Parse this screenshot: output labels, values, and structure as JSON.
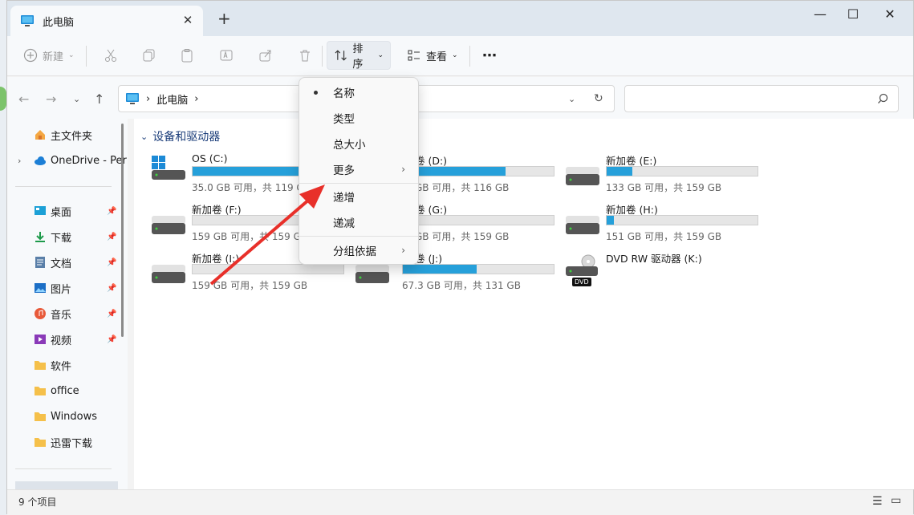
{
  "window": {
    "tab_title": "此电脑",
    "close_tab": "✕",
    "new_tab": "+",
    "minimize": "—",
    "maximize": "☐",
    "close": "✕"
  },
  "toolbar": {
    "new_label": "新建",
    "sort_label": "排序",
    "view_label": "查看",
    "more_label": "⋯"
  },
  "address": {
    "crumb": "此电脑",
    "sep": "›"
  },
  "sidebar": {
    "items": [
      {
        "label": "主文件夹"
      },
      {
        "label": "OneDrive - Per"
      },
      {
        "label": "桌面"
      },
      {
        "label": "下载"
      },
      {
        "label": "文档"
      },
      {
        "label": "图片"
      },
      {
        "label": "音乐"
      },
      {
        "label": "视频"
      },
      {
        "label": "软件"
      },
      {
        "label": "office"
      },
      {
        "label": "Windows"
      },
      {
        "label": "迅雷下载"
      }
    ]
  },
  "content": {
    "group_title": "设备和驱动器",
    "drives": [
      {
        "name": "OS (C:)",
        "free": "35.0 GB 可用，共 119 GB",
        "fill": 0.71
      },
      {
        "name": "卷 (D:)",
        "free": "GB 可用，共 116 GB",
        "fill": 0.68
      },
      {
        "name": "新加卷 (E:)",
        "free": "133 GB 可用，共 159 GB",
        "fill": 0.17
      },
      {
        "name": "新加卷 (F:)",
        "free": "159 GB 可用，共 159 GB",
        "fill": 0.0
      },
      {
        "name": "卷 (G:)",
        "free": "GB 可用，共 159 GB",
        "fill": 0.0
      },
      {
        "name": "新加卷 (H:)",
        "free": "151 GB 可用，共 159 GB",
        "fill": 0.05
      },
      {
        "name": "新加卷 (I:)",
        "free": "159 GB 可用，共 159 GB",
        "fill": 0.0
      },
      {
        "name": "卷 (J:)",
        "free": "67.3 GB 可用，共 131 GB",
        "fill": 0.49
      },
      {
        "name": "DVD RW 驱动器 (K:)",
        "free": "",
        "fill": 0.0
      }
    ],
    "dvd_badge": "DVD"
  },
  "menu": {
    "items": [
      "名称",
      "类型",
      "总大小",
      "更多",
      "递增",
      "递减",
      "分组依据"
    ]
  },
  "status": {
    "count": "9 个项目"
  },
  "colors": {
    "accent": "#26a0da",
    "arrow": "#e8302a"
  }
}
